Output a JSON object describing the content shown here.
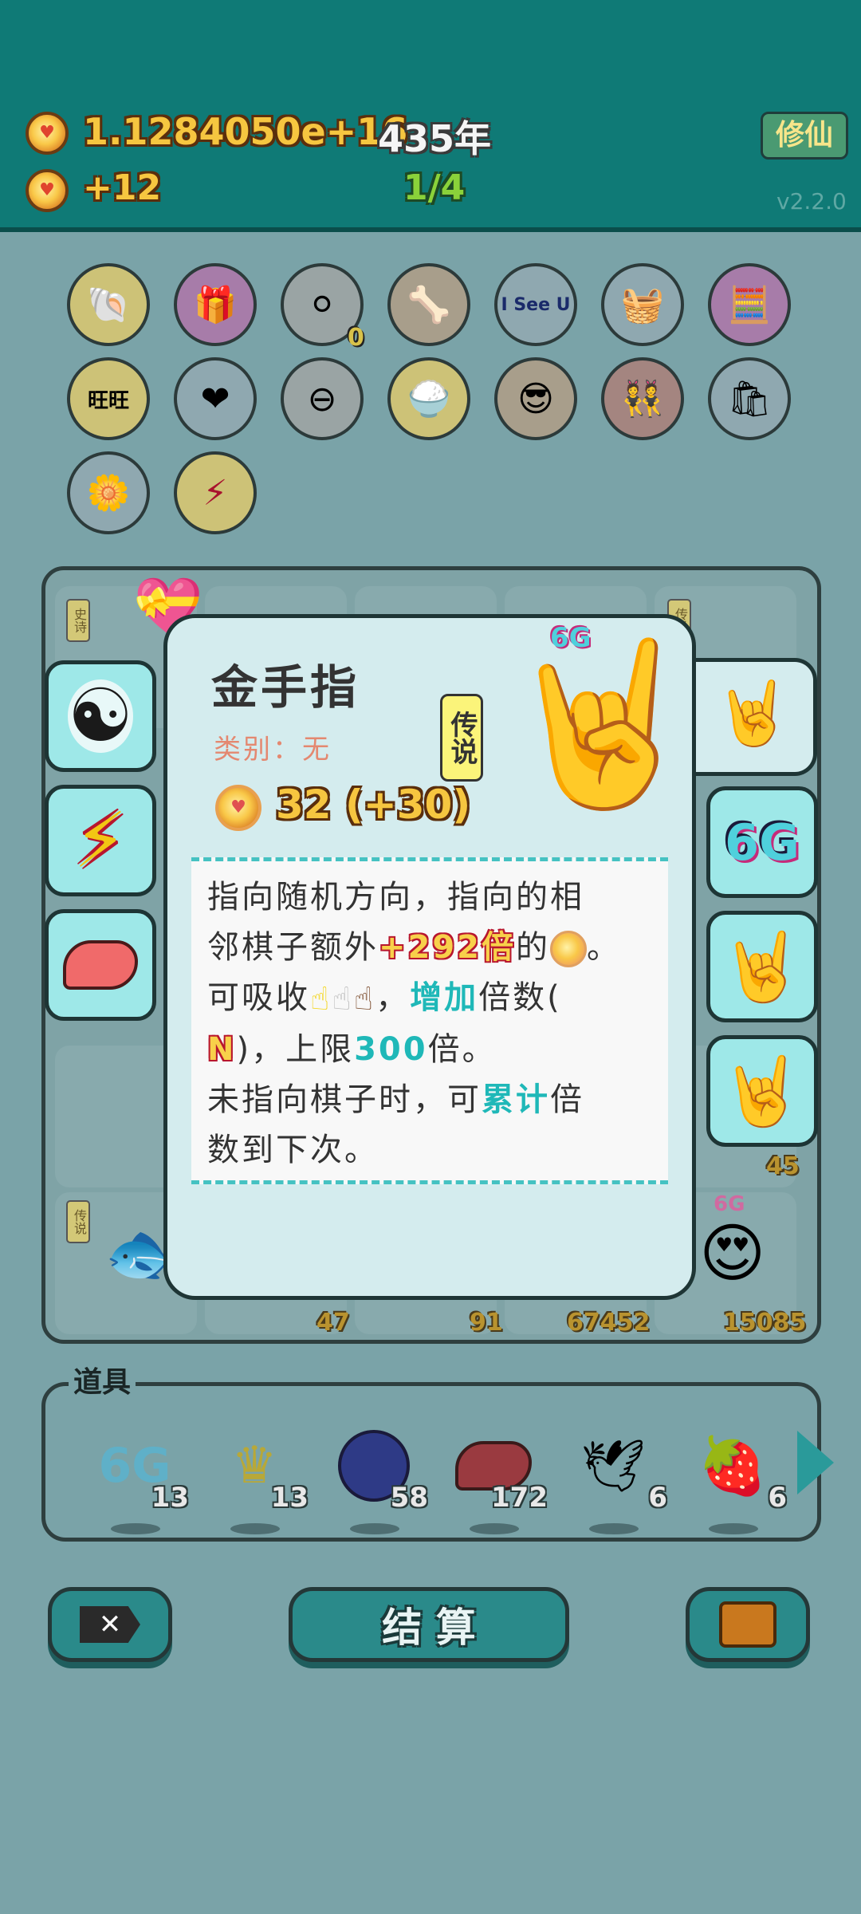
{
  "header": {
    "coins": "1.1284050e+16",
    "years": "435年",
    "income": "+12",
    "progress": "1/4",
    "cultivate_button": "修仙",
    "version": "v2.2.0"
  },
  "popup": {
    "title": "金手指",
    "category": "类别：无",
    "rarity": "传说",
    "value": "32 (+30)",
    "item_badge": "6G",
    "description": {
      "l1": "指向随机方向，指向的相",
      "l2_a": "邻棋子额外",
      "l2_b": "+292倍",
      "l2_c": "的",
      "l2_d": "。",
      "l3_a": "可吸收",
      "l3_b": "，",
      "l3_c": "增加",
      "l3_d": "倍数(",
      "l4_a": "N",
      "l4_b": ")，上限",
      "l4_c": "300",
      "l4_d": "倍。",
      "l5_a": "未指向棋子时，可",
      "l5_b": "累计",
      "l5_c": "倍",
      "l6": "数到下次。"
    }
  },
  "left_slots": [
    "yin-yang",
    "lightning",
    "liver"
  ],
  "right_slots": [
    {
      "label": "",
      "icon": "yellow-hand"
    },
    {
      "label": "6G",
      "icon": "6g"
    },
    {
      "label": "",
      "icon": "white-hand"
    },
    {
      "label": "",
      "icon": "brown-hand"
    }
  ],
  "top_item_badge": "0",
  "board": {
    "cell_values": [
      "45",
      "47",
      "91",
      "67452",
      "15085"
    ],
    "side_badge": "6G",
    "legend_tags": [
      "史诗",
      "史诗",
      "传说",
      "传说"
    ]
  },
  "tools": {
    "title": "道具",
    "items": [
      {
        "name": "6g",
        "count": "13"
      },
      {
        "name": "crown",
        "count": "13"
      },
      {
        "name": "blueberry",
        "count": "58"
      },
      {
        "name": "liver",
        "count": "172"
      },
      {
        "name": "pigeon",
        "count": "6"
      },
      {
        "name": "strawberry",
        "count": "6"
      }
    ]
  },
  "bottom": {
    "settle_button": "结 算"
  }
}
